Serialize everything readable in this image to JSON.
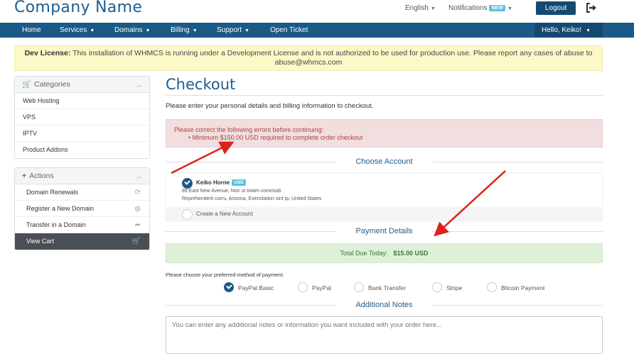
{
  "header": {
    "brand": "Company Name",
    "language": "English",
    "notifications": "Notifications",
    "notifications_badge": "NEW",
    "logout": "Logout",
    "exit_icon": "sign-out-icon"
  },
  "navbar": {
    "home": "Home",
    "services": "Services",
    "domains": "Domains",
    "billing": "Billing",
    "support": "Support",
    "open_ticket": "Open Ticket",
    "user": "Hello, Keiko!"
  },
  "dev_alert": {
    "label": "Dev License:",
    "text": "This installation of WHMCS is running under a Development License and is not authorized to be used for production use. Please report any cases of abuse to abuse@whmcs.com"
  },
  "sidebar": {
    "categories": {
      "title": "Categories",
      "items": [
        "Web Hosting",
        "VPS",
        "IPTV",
        "Product Addons"
      ]
    },
    "actions": {
      "title": "Actions",
      "items": [
        "Domain Renewals",
        "Register a New Domain",
        "Transfer in a Domain",
        "View Cart"
      ]
    }
  },
  "main": {
    "title": "Checkout",
    "intro": "Please enter your personal details and billing information to checkout.",
    "error_heading": "Please correct the following errors before continuing:",
    "error_item": "Minimum $150.00 USD required to complete order checkout",
    "choose_account": "Choose Account",
    "account": {
      "name": "Keiko Horne",
      "currency": "USD",
      "address1": "89 East New Avenue, Non ut totam commodi",
      "address2": "Reprehenderit corru, Arizona, Exercitation sint ip, United States",
      "create_new": "Create a New Account"
    },
    "payment_details": "Payment Details",
    "total_label": "Total Due Today:",
    "total_value": "$15.00 USD",
    "payment_instructions": "Please choose your preferred method of payment.",
    "payment_methods": [
      "PayPal Basic",
      "PayPal",
      "Bank Transfer",
      "Stripe",
      "Bitcoin Payment"
    ],
    "selected_payment": "PayPal Basic",
    "additional_notes": "Additional Notes",
    "notes_placeholder": "You can enter any additional notes or information you want included with your order here..."
  },
  "colors": {
    "brand": "#1f5d8f",
    "navbar": "#1b5a87",
    "annotation_arrow": "#e0201a"
  }
}
